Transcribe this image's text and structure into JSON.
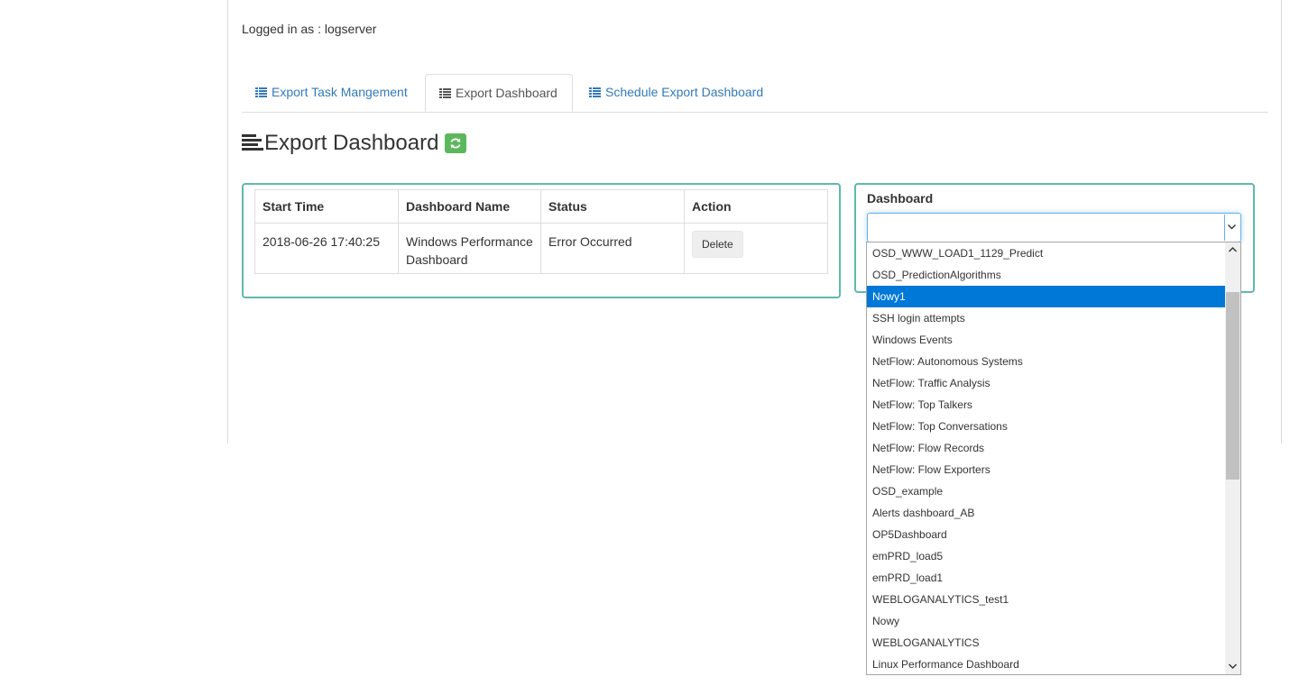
{
  "header": {
    "logged_in_text": "Logged in as : logserver"
  },
  "tabs": [
    {
      "label": "Export Task Mangement",
      "active": false
    },
    {
      "label": "Export Dashboard",
      "active": true
    },
    {
      "label": "Schedule Export Dashboard",
      "active": false
    }
  ],
  "page_title": "Export Dashboard",
  "table": {
    "headers": [
      "Start Time",
      "Dashboard Name",
      "Status",
      "Action"
    ],
    "rows": [
      {
        "start_time": "2018-06-26 17:40:25",
        "dashboard_name_line1": "Windows Performance",
        "dashboard_name_line2": "Dashboard",
        "status": "Error Occurred",
        "action": "Delete"
      }
    ]
  },
  "dashboard_select": {
    "label": "Dashboard",
    "value": "",
    "selected_option": "Nowy1",
    "options": [
      "OSD_WWW_LOAD1_1129_Predict",
      "OSD_PredictionAlgorithms",
      "Nowy1",
      "SSH login attempts",
      "Windows Events",
      "NetFlow: Autonomous Systems",
      "NetFlow: Traffic Analysis",
      "NetFlow: Top Talkers",
      "NetFlow: Top Conversations",
      "NetFlow: Flow Records",
      "NetFlow: Flow Exporters",
      "OSD_example",
      "Alerts dashboard_AB",
      "OP5Dashboard",
      "emPRD_load5",
      "emPRD_load1",
      "WEBLOGANALYTICS_test1",
      "Nowy",
      "WEBLOGANALYTICS",
      "Linux Performance Dashboard"
    ]
  },
  "colors": {
    "link": "#337ab7",
    "panel_border": "#5fb9ac",
    "refresh_button": "#5cb85c",
    "option_selected": "#0078d7",
    "focus_border": "#66afe9"
  },
  "icons": {
    "tab_icon": "list-icon",
    "title_icon": "align-left-icon",
    "refresh_icon": "refresh-icon",
    "select_arrow": "chevron-down-icon"
  }
}
